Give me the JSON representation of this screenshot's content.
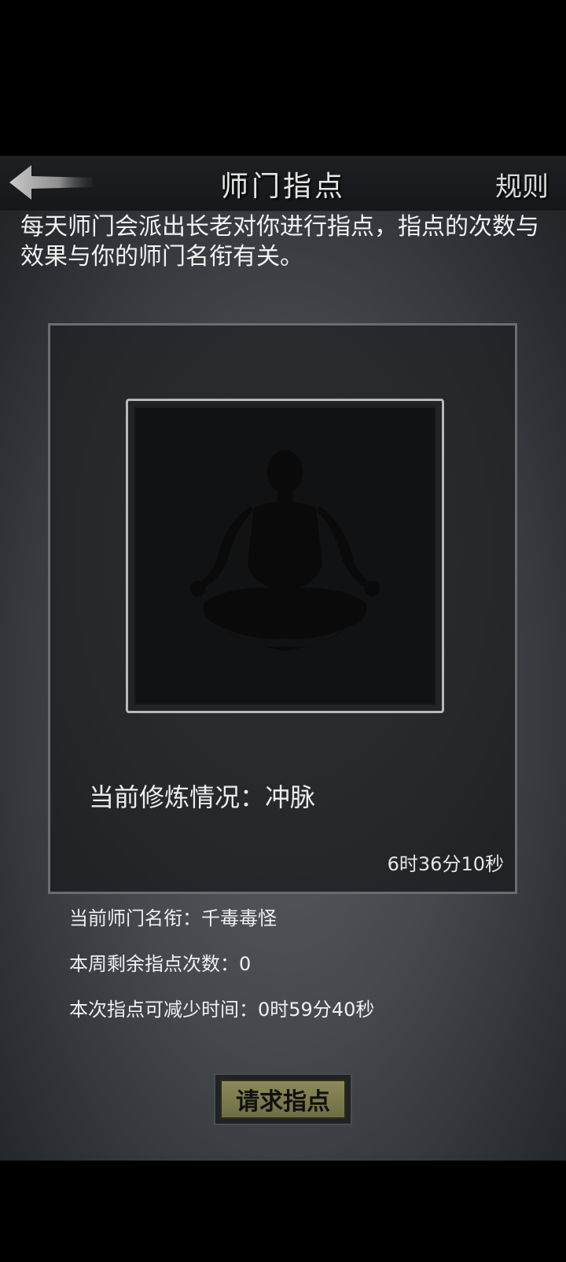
{
  "header": {
    "title": "师门指点",
    "rules_label": "规则",
    "back_icon": "back-arrow-icon"
  },
  "intro_text": "每天师门会派出长老对你进行指点，指点的次数与效果与你的师门名衔有关。",
  "card": {
    "portrait_icon": "meditating-figure-icon",
    "status_text": "当前修炼情况：冲脉",
    "timer_text": "6时36分10秒"
  },
  "info": {
    "rank_text": "当前师门名衔：千毒毒怪",
    "remaining_text": "本周剩余指点次数：0",
    "reduce_text": "本次指点可减少时间：0时59分40秒"
  },
  "request_button_label": "请求指点",
  "colors": {
    "button_face": "#8c8a5a",
    "background": "#44484c"
  }
}
